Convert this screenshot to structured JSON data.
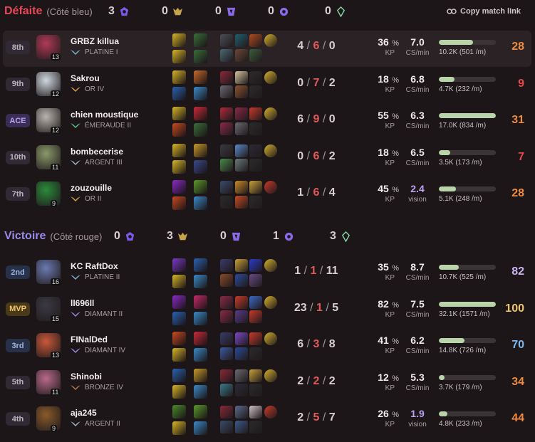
{
  "copy_link": "Copy match link",
  "loss_team": {
    "name": "Défaite",
    "side": "(Côté bleu)",
    "objectives": [
      "3",
      "0",
      "0",
      "0",
      "0"
    ],
    "players": [
      {
        "badge": "8th",
        "badge_type": "",
        "name": "GRBZ killua",
        "rank": "PLATINE I",
        "level": "13",
        "k": "4",
        "d": "6",
        "a": "0",
        "kp": "36",
        "cs": "7.0",
        "cs_label": "CS/min",
        "dmg": "10.2K (501 /m)",
        "dmg_pct": 0.6,
        "score": "28",
        "score_color": "#f08a3c",
        "highlight": true,
        "champ_color": "#b03a56",
        "rank_color": "#7eb3d0",
        "spells": [
          "#d8b628",
          "#3a6f3a",
          "#d8b628",
          "#3a6f3a"
        ],
        "items": [
          "#4a5058",
          "#1f6070",
          "#b04a20",
          "#d6b02e",
          "#4a6a74",
          "#6a4836",
          "#3c5c3c",
          ""
        ]
      },
      {
        "badge": "9th",
        "badge_type": "",
        "name": "Sakrou",
        "rank": "OR IV",
        "level": "12",
        "k": "0",
        "d": "7",
        "a": "2",
        "kp": "18",
        "cs": "6.8",
        "cs_label": "CS/min",
        "dmg": "4.7K (232 /m)",
        "dmg_pct": 0.28,
        "score": "9",
        "score_color": "#e84848",
        "highlight": false,
        "champ_color": "#cfd8e0",
        "rank_color": "#d8a04a",
        "spells": [
          "#d8b628",
          "#c86a2a",
          "#2a62b0",
          "#3a8ac8"
        ],
        "items": [
          "#8a2838",
          "#d6c4a0",
          "#2b2b2b",
          "#d6b02e",
          "#6a6a72",
          "#8a5430",
          "#2b2b2b",
          ""
        ]
      },
      {
        "badge": "ACE",
        "badge_type": "ace",
        "name": "chien moustique",
        "rank": "ÉMERAUDE II",
        "level": "12",
        "k": "6",
        "d": "9",
        "a": "0",
        "kp": "55",
        "cs": "6.3",
        "cs_label": "CS/min",
        "dmg": "17.0K (834 /m)",
        "dmg_pct": 1.0,
        "score": "31",
        "score_color": "#f08a3c",
        "highlight": false,
        "champ_color": "#b8b4ae",
        "rank_color": "#5cc08a",
        "spells": [
          "#d8b628",
          "#c82a3a",
          "#c84a22",
          "#3a6f3a"
        ],
        "items": [
          "#b02a3a",
          "#8a2a48",
          "#c83a2a",
          "#d6b02e",
          "#8a2a48",
          "#6a6a72",
          "#2b2b2b",
          ""
        ]
      },
      {
        "badge": "10th",
        "badge_type": "",
        "name": "bombecerise",
        "rank": "ARGENT III",
        "level": "11",
        "k": "0",
        "d": "6",
        "a": "2",
        "kp": "18",
        "cs": "6.5",
        "cs_label": "CS/min",
        "dmg": "3.5K (173 /m)",
        "dmg_pct": 0.2,
        "score": "7",
        "score_color": "#e84848",
        "highlight": false,
        "champ_color": "#8a9a6a",
        "rank_color": "#a8b4c4",
        "spells": [
          "#d8b628",
          "#c89a2a",
          "#d8b628",
          "#3a4a8a"
        ],
        "items": [
          "#3a3a42",
          "#5a8ac8",
          "#2a2a36",
          "#d6b02e",
          "#4a8a4a",
          "#6a7a7a",
          "#2b2b2b",
          ""
        ]
      },
      {
        "badge": "7th",
        "badge_type": "",
        "name": "zouzouille",
        "rank": "OR II",
        "level": "9",
        "k": "1",
        "d": "6",
        "a": "4",
        "kp": "45",
        "cs": "2.4",
        "cs_label": "vision",
        "vis": true,
        "dmg": "5.1K (248 /m)",
        "dmg_pct": 0.3,
        "score": "28",
        "score_color": "#f08a3c",
        "highlight": false,
        "champ_color": "#2a8a3a",
        "rank_color": "#d8a04a",
        "spells": [
          "#8a2ac8",
          "#5a9a2a",
          "#c84a22",
          "#3a8ac8"
        ],
        "items": [
          "#3a4a6a",
          "#c88a2a",
          "#c8a03a",
          "#c83a2a",
          "#2b2b2b",
          "#c84a22",
          "#2b2b2b",
          ""
        ]
      }
    ]
  },
  "win_team": {
    "name": "Victoire",
    "side": "(Côté rouge)",
    "objectives": [
      "0",
      "3",
      "0",
      "1",
      "3"
    ],
    "players": [
      {
        "badge": "2nd",
        "badge_type": "blue",
        "name": "KC RaftDox",
        "rank": "PLATINE II",
        "level": "16",
        "k": "1",
        "d": "1",
        "a": "11",
        "kp": "35",
        "cs": "8.7",
        "cs_label": "CS/min",
        "dmg": "10.7K (525 /m)",
        "dmg_pct": 0.35,
        "score": "82",
        "score_color": "#c8b4f2",
        "highlight": false,
        "champ_color": "#6a7ab0",
        "rank_color": "#7eb3d0",
        "spells": [
          "#7a3ac8",
          "#2a62b0",
          "#d8b628",
          "#3a8ac8"
        ],
        "items": [
          "#3a3a6a",
          "#c8a03a",
          "#2a3ac8",
          "#d6b02e",
          "#8a4a2a",
          "#2a4a9a",
          "#6a4a8a",
          ""
        ]
      },
      {
        "badge": "MVP",
        "badge_type": "mvp",
        "name": "ll696ll",
        "rank": "DIAMANT II",
        "level": "15",
        "k": "23",
        "d": "1",
        "a": "5",
        "kp": "82",
        "cs": "7.5",
        "cs_label": "CS/min",
        "dmg": "32.1K (1571 /m)",
        "dmg_pct": 1.0,
        "score": "100",
        "score_color": "#f0c668",
        "highlight": false,
        "champ_color": "#3a3a44",
        "rank_color": "#9a8ae8",
        "spells": [
          "#8a2ac8",
          "#c82a6a",
          "#2a62b0",
          "#3a8ac8"
        ],
        "items": [
          "#8a2a48",
          "#c83a2a",
          "#3a6ac8",
          "#d6b02e",
          "#8a2a48",
          "#5a3a8a",
          "#c83a2a",
          ""
        ]
      },
      {
        "badge": "3rd",
        "badge_type": "blue",
        "name": "FINalDed",
        "rank": "DIAMANT IV",
        "level": "13",
        "k": "6",
        "d": "3",
        "a": "8",
        "kp": "41",
        "cs": "6.2",
        "cs_label": "CS/min",
        "dmg": "14.8K (726 /m)",
        "dmg_pct": 0.45,
        "score": "70",
        "score_color": "#7ab8f2",
        "highlight": false,
        "champ_color": "#c8583a",
        "rank_color": "#9a8ae8",
        "spells": [
          "#c84a22",
          "#c82a3a",
          "#d8b628",
          "#3a8ac8"
        ],
        "items": [
          "#3a3a6a",
          "#7a4ac8",
          "#c83a2a",
          "#d6b02e",
          "#3a5aa0",
          "#2a4a9a",
          "#2b2b2b",
          ""
        ]
      },
      {
        "badge": "5th",
        "badge_type": "",
        "name": "Shinobi",
        "rank": "BRONZE IV",
        "level": "11",
        "k": "2",
        "d": "2",
        "a": "2",
        "kp": "12",
        "cs": "5.3",
        "cs_label": "CS/min",
        "dmg": "3.7K (179 /m)",
        "dmg_pct": 0.1,
        "score": "34",
        "score_color": "#f08a3c",
        "highlight": false,
        "champ_color": "#b86a8a",
        "rank_color": "#b87a4a",
        "spells": [
          "#2a62b0",
          "#c89a2a",
          "#d8b628",
          "#3a8ac8"
        ],
        "items": [
          "#8a2838",
          "#6a6a72",
          "#c8a03a",
          "#d6b02e",
          "#3a7a8a",
          "#2a2a36",
          "#2b2b2b",
          ""
        ]
      },
      {
        "badge": "4th",
        "badge_type": "",
        "name": "aja245",
        "rank": "ARGENT II",
        "level": "9",
        "k": "2",
        "d": "5",
        "a": "7",
        "kp": "26",
        "cs": "1.9",
        "cs_label": "vision",
        "vis": true,
        "dmg": "4.8K (233 /m)",
        "dmg_pct": 0.15,
        "score": "44",
        "score_color": "#f08a3c",
        "highlight": false,
        "champ_color": "#8a5a2a",
        "rank_color": "#a8b4c4",
        "spells": [
          "#4a8a2a",
          "#5a9a2a",
          "#d8b628",
          "#3a8ac8"
        ],
        "items": [
          "#8a2838",
          "#5a6a8a",
          "#d0c0c8",
          "#c83a2a",
          "#3a4a6a",
          "#3a5a8a",
          "#2b2b2b",
          ""
        ]
      }
    ]
  }
}
